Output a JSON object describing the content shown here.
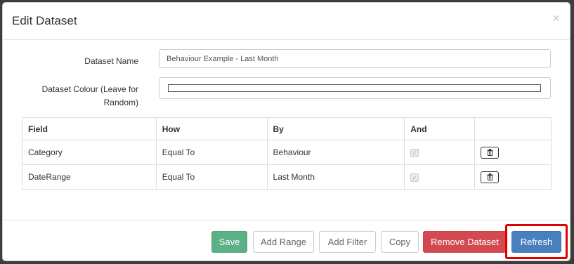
{
  "modal": {
    "title": "Edit Dataset",
    "close_glyph": "×"
  },
  "form": {
    "dataset_name_label": "Dataset Name",
    "dataset_name_value": "Behaviour Example - Last Month",
    "dataset_colour_label_line1": "Dataset Colour (Leave for",
    "dataset_colour_label_line2": "Random)"
  },
  "table": {
    "headers": [
      "Field",
      "How",
      "By",
      "And",
      ""
    ],
    "rows": [
      {
        "field": "Category",
        "how": "Equal To",
        "by": "Behaviour",
        "and_checked": true
      },
      {
        "field": "DateRange",
        "how": "Equal To",
        "by": "Last Month",
        "and_checked": true
      }
    ],
    "delete_icon": "trash-icon"
  },
  "footer": {
    "save_label": "Save",
    "add_range_label": "Add Range",
    "add_filter_label": "Add Filter",
    "copy_label": "Copy",
    "remove_dataset_label": "Remove Dataset",
    "refresh_label": "Refresh"
  },
  "colors": {
    "save": "#5cb085",
    "remove": "#d2494f",
    "refresh": "#4a7fbd",
    "highlight": "#e00000"
  }
}
